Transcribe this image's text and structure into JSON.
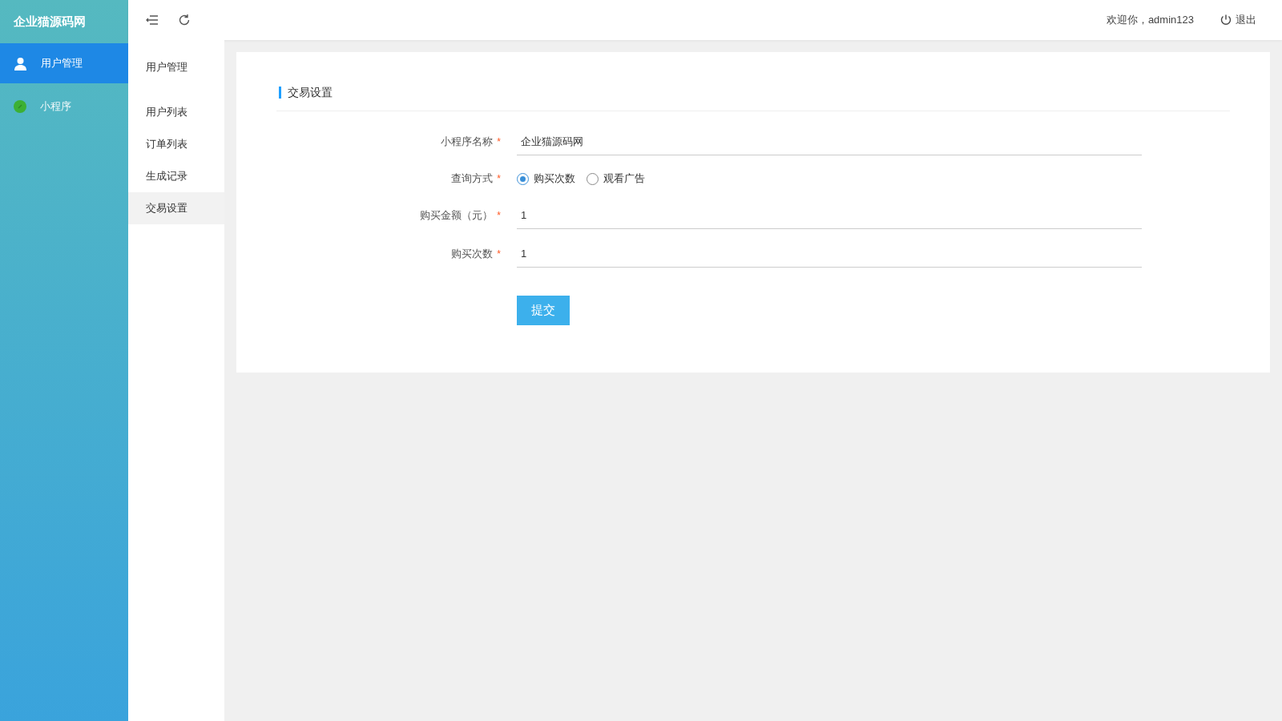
{
  "sidebar": {
    "logo": "企业猫源码网",
    "items": [
      {
        "label": "用户管理",
        "kind": "user",
        "selected": true
      },
      {
        "label": "小程序",
        "kind": "link",
        "selected": false
      }
    ]
  },
  "submenu": {
    "title": "用户管理",
    "items": [
      {
        "label": "用户列表",
        "selected": false
      },
      {
        "label": "订单列表",
        "selected": false
      },
      {
        "label": "生成记录",
        "selected": false
      },
      {
        "label": "交易设置",
        "selected": true
      }
    ]
  },
  "topbar": {
    "welcome": "欢迎你，admin123",
    "logout": "退出"
  },
  "card": {
    "title": "交易设置",
    "fields": [
      {
        "kind": "text",
        "label": "小程序名称",
        "required_mark": "*",
        "value": "企业猫源码网"
      },
      {
        "kind": "radio",
        "label": "查询方式",
        "required_mark": "*",
        "options": [
          {
            "label": "购买次数",
            "selected": true
          },
          {
            "label": "观看广告",
            "selected": false
          }
        ]
      },
      {
        "kind": "text",
        "label": "购买金额（元）",
        "required_mark": "*",
        "value": "1"
      },
      {
        "kind": "text",
        "label": "购买次数",
        "required_mark": "*",
        "value": "1"
      }
    ],
    "submit": "提交"
  }
}
